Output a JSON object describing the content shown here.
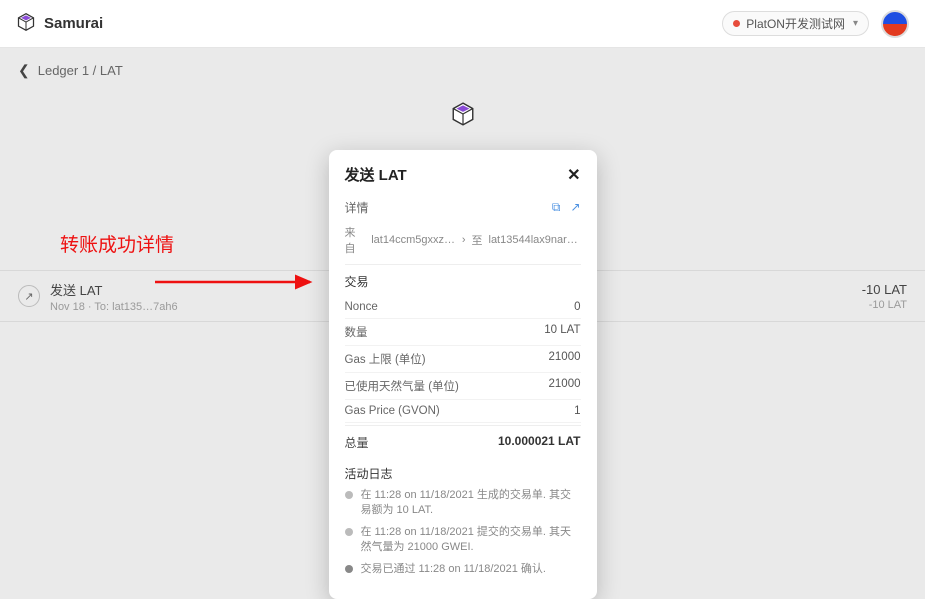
{
  "brand": "Samurai",
  "network": {
    "label": "PlatON开发测试网"
  },
  "breadcrumb": {
    "back_aria": "Back",
    "line": "Ledger 1 / LAT"
  },
  "tx_row": {
    "title": "发送 LAT",
    "sub": "Nov 18 · To: lat135…7ah6",
    "amount": "-10 LAT",
    "amount_sub": "-10 LAT"
  },
  "annotation": "转账成功详情",
  "modal": {
    "title": "发送 LAT",
    "detail_label": "详情",
    "from_label": "来自",
    "from_addr": "lat14ccm5gxxz7…",
    "to_label": "至",
    "to_addr": "lat13544lax9nare2…",
    "tx_label": "交易",
    "rows": {
      "nonce_k": "Nonce",
      "nonce_v": "0",
      "qty_k": "数量",
      "qty_v": "10 LAT",
      "gaslimit_k": "Gas 上限 (单位)",
      "gaslimit_v": "21000",
      "gasused_k": "已使用天然气量 (单位)",
      "gasused_v": "21000",
      "gasprice_k": "Gas Price (GVON)",
      "gasprice_v": "1"
    },
    "total_k": "总量",
    "total_v": "10.000021 LAT",
    "log_title": "活动日志",
    "logs": [
      "在 11:28 on 11/18/2021 生成的交易单. 其交易额为 10 LAT.",
      "在 11:28 on 11/18/2021 提交的交易单. 其天然气量为 21000 GWEI.",
      "交易已通过 11:28 on 11/18/2021 确认."
    ]
  }
}
